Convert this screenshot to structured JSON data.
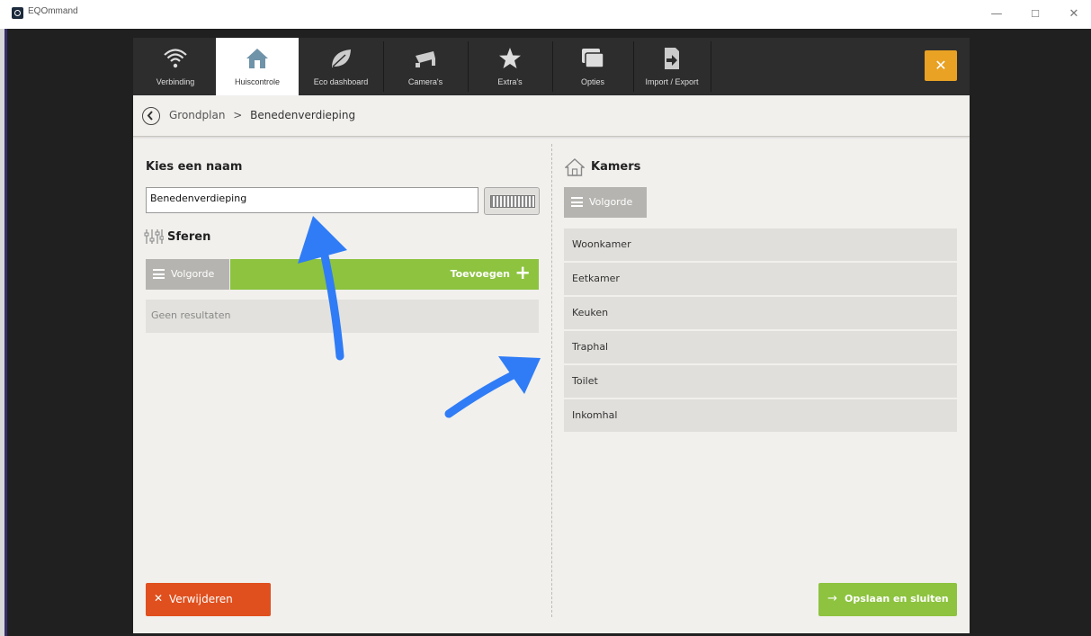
{
  "window": {
    "title": "EQOmmand",
    "minimize": "—",
    "maximize": "☐",
    "close": "✕"
  },
  "tabs": [
    {
      "label": "Verbinding",
      "icon": "wifi-icon"
    },
    {
      "label": "Huiscontrole",
      "icon": "house-icon",
      "active": true
    },
    {
      "label": "Eco dashboard",
      "icon": "leaf-icon"
    },
    {
      "label": "Camera's",
      "icon": "camera-icon"
    },
    {
      "label": "Extra's",
      "icon": "star-icon"
    },
    {
      "label": "Opties",
      "icon": "windows-icon"
    },
    {
      "label": "Import / Export",
      "icon": "import-export-icon"
    }
  ],
  "close_button": "✕",
  "breadcrumb": {
    "parent": "Grondplan",
    "separator": ">",
    "current": "Benedenverdieping"
  },
  "left": {
    "name_title": "Kies een naam",
    "name_value": "Benedenverdieping",
    "spheres_title": "Sferen",
    "order_label": "Volgorde",
    "add_label": "Toevoegen",
    "add_icon": "+",
    "empty_text": "Geen resultaten",
    "delete_icon": "✕",
    "delete_label": "Verwijderen"
  },
  "right": {
    "rooms_title": "Kamers",
    "order_label": "Volgorde",
    "rooms": [
      "Woonkamer",
      "Eetkamer",
      "Keuken",
      "Traphal",
      "Toilet",
      "Inkomhal"
    ],
    "save_icon": "→",
    "save_label": "Opslaan en sluiten"
  },
  "colors": {
    "accent_orange": "#e9a224",
    "green": "#8dc33f",
    "red": "#e0501e",
    "annotation_arrow": "#2f7cf6"
  }
}
